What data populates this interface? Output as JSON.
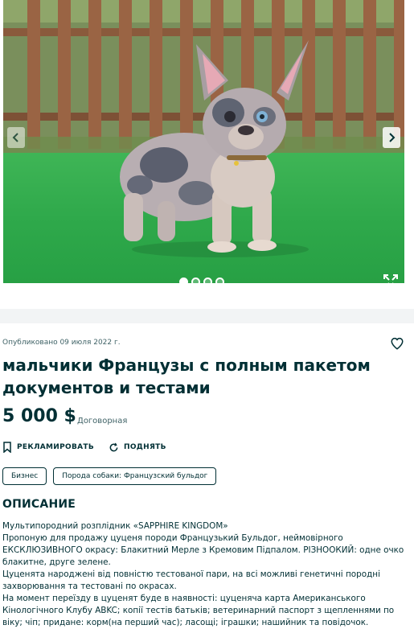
{
  "gallery": {
    "image_alt": "French bulldog puppy (blue merle) standing on green grass in front of a wooden fence",
    "prev_icon": "chevron-left-icon",
    "next_icon": "chevron-right-icon",
    "expand_icon": "expand-icon",
    "image_count": 4,
    "active_index": 0
  },
  "ad": {
    "published": "Опубликовано 09 июля 2022 г.",
    "title": "мальчики Французы с полным пакетом документов и тестами",
    "price": "5 000 $",
    "price_note": "Договорная",
    "favorite_icon": "heart-outline-icon"
  },
  "actions": {
    "promote_label": "РЕКЛАМИРОВАТЬ",
    "raise_label": "ПОДНЯТЬ"
  },
  "tags": [
    "Бизнес",
    "Порода собаки: Французский бульдог"
  ],
  "description": {
    "heading": "ОПИСАНИЕ",
    "lines": [
      "Мультипородний розплідник «SAPPHIRE KINGDOM»",
      "Пропоную для продажу цуценя породи Французький Бульдог, неймовірного ЕКСКЛЮЗИВНОГО окрасу: Блакитний Мерле з Кремовим Підпалом. РІЗНООКИЙ: одне очко блакитне, друге зелене.",
      "Цуценята народжені від повністю тестованої пари, на всі можливі генетичні породні захворювання та тестовані по окрасах.",
      "На момент переїзду в цуценят буде в наявності: цуценяча карта Американського Кінологічного Клубу ABKC; копії тестів батьків; ветеринарний паспорт з щепленнями по віку; чіп; придане: корм(на перший час); ласощі; іграшки; нашийник та повідочок."
    ]
  }
}
